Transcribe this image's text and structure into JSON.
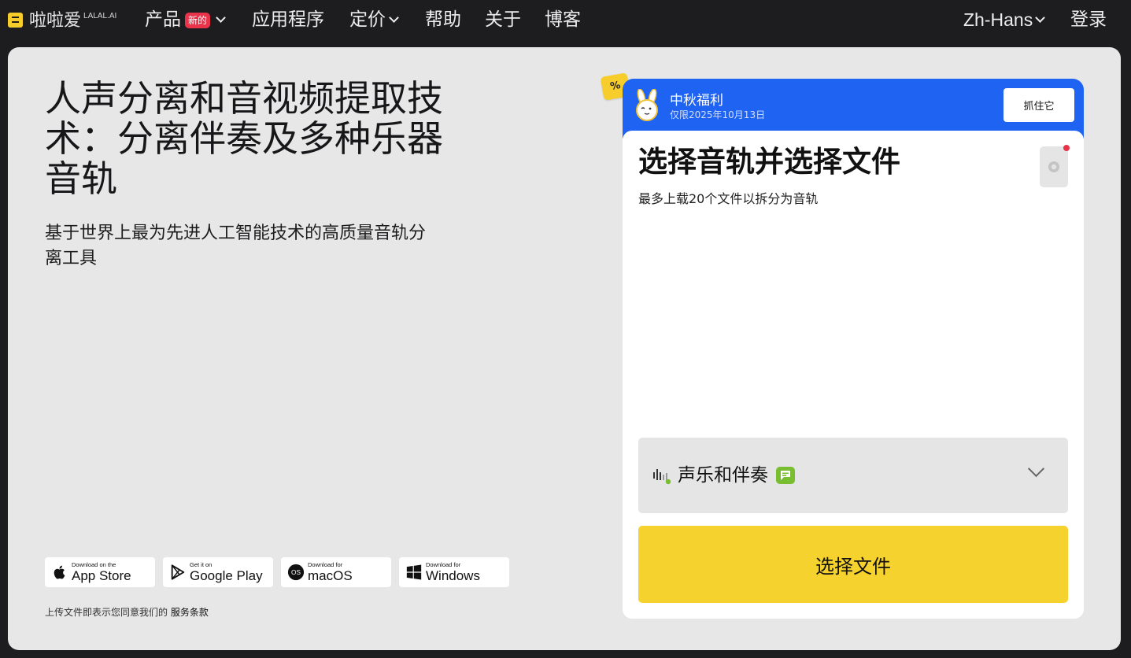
{
  "nav": {
    "logo_text": "啦啦爱",
    "logo_sup": "LALAL.AI",
    "items": [
      {
        "label": "产品",
        "badge": "新的",
        "has_dropdown": true
      },
      {
        "label": "应用程序"
      },
      {
        "label": "定价",
        "has_dropdown": true
      },
      {
        "label": "帮助"
      },
      {
        "label": "关于"
      },
      {
        "label": "博客"
      }
    ],
    "language": "Zh-Hans",
    "login": "登录"
  },
  "hero": {
    "title": "人声分离和音视频提取技术：分离伴奏及多种乐器音轨",
    "subtitle": "基于世界上最为先进人工智能技术的高质量音轨分离工具"
  },
  "stores": [
    {
      "small": "Download on the",
      "big": "App Store",
      "icon": "apple-icon"
    },
    {
      "small": "Get it on",
      "big": "Google Play",
      "icon": "google-play-icon"
    },
    {
      "small": "Download for",
      "big": "macOS",
      "icon": "macos-icon"
    },
    {
      "small": "Download for",
      "big": "Windows",
      "icon": "windows-icon"
    }
  ],
  "terms": {
    "text": "上传文件即表示您同意我们的",
    "link": "服务条款"
  },
  "promo": {
    "tag": "%",
    "title": "中秋福利",
    "date": "仅限2025年10月13日",
    "button": "抓住它"
  },
  "upload": {
    "title": "选择音轨并选择文件",
    "subtitle": "最多上载20个文件以拆分为音轨",
    "stem_select": "声乐和伴奏",
    "choose_button": "选择文件"
  },
  "colors": {
    "accent_yellow": "#f6d22e",
    "promo_blue": "#1f63f2",
    "badge_red": "#e8334a",
    "badge_green": "#79bd31",
    "nav_bg": "#1d1c1f",
    "card_bg": "#e7e7e7"
  }
}
